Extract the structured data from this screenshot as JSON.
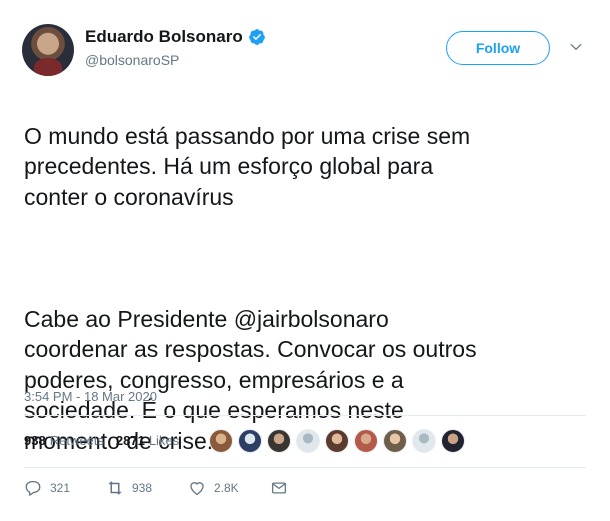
{
  "author": {
    "display_name": "Eduardo Bolsonaro",
    "handle": "@bolsonaroSP",
    "verified_icon": "verified-badge-icon"
  },
  "follow_label": "Follow",
  "tweet": {
    "paragraph1": "O mundo está passando por uma crise sem\nprecedentes. Há um esforço global para\nconter o coronavírus",
    "paragraph2_before": "Cabe ao Presidente ",
    "mention": "@jairbolsonaro",
    "paragraph2_after": "\ncoordenar as respostas. Convocar os outros\npoderes, congresso, empresários e a\nsociedade. É o que esperamos neste\nmomento de crise.",
    "timestamp": "3:54 PM - 18 Mar 2020"
  },
  "stats": {
    "retweets_count": "938",
    "retweets_label": "Retweets",
    "likes_count": "2871",
    "likes_label": "Likes"
  },
  "actions": {
    "replies": "321",
    "retweets": "938",
    "likes": "2.8K"
  },
  "colors": {
    "accent": "#1da1f2",
    "text": "#14171a",
    "secondary": "#657786",
    "divider": "#e6ecf0"
  }
}
